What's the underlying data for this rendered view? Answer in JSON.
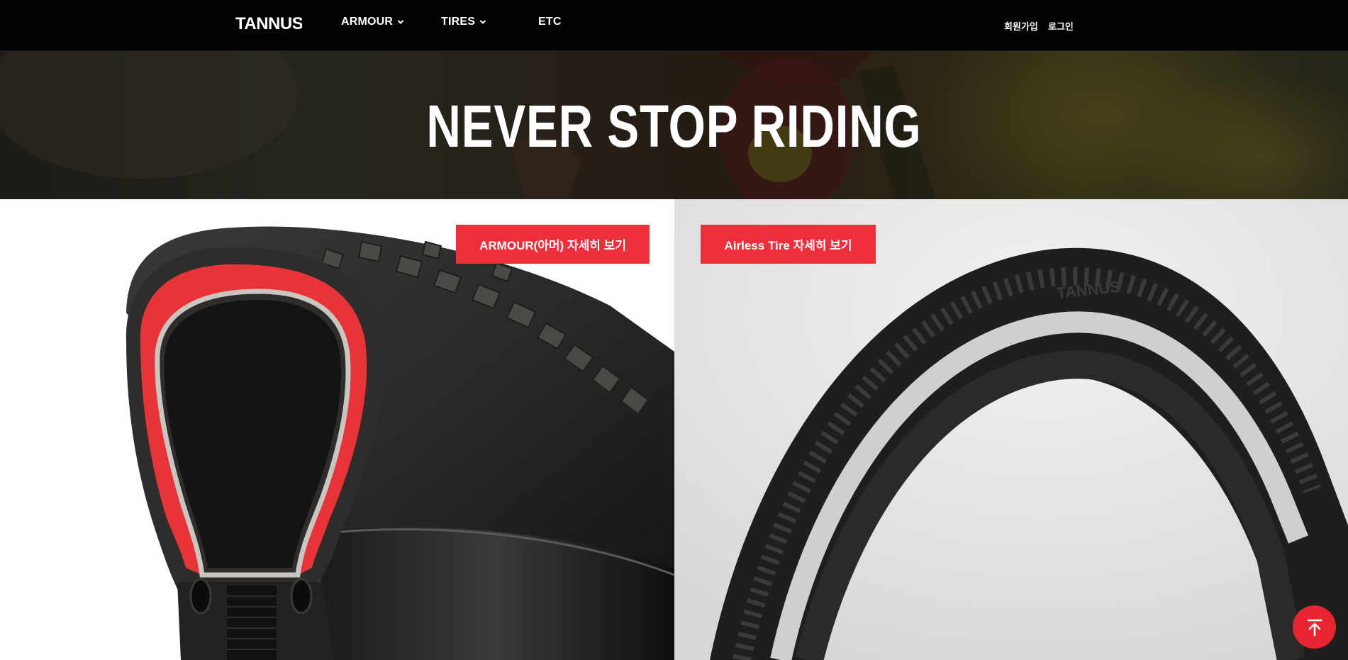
{
  "header": {
    "logo_text": "TANNUS",
    "nav": [
      {
        "label": "ARMOUR",
        "has_dropdown": true
      },
      {
        "label": "TIRES",
        "has_dropdown": true
      },
      {
        "label": "ETC",
        "has_dropdown": false
      }
    ],
    "account": {
      "signup_label": "회원가입",
      "login_label": "로그인"
    }
  },
  "hero": {
    "title": "NEVER STOP RIDING"
  },
  "products": {
    "armour": {
      "cta_label": "ARMOUR(아머) 자세히 보기",
      "icon": "tire-armour-cross-section"
    },
    "airless": {
      "cta_label": "Airless Tire 자세히 보기",
      "tire_brand": "TANNUS",
      "icon": "airless-road-tire"
    }
  },
  "scroll_top": {
    "icon": "arrow-up-to-top-icon"
  },
  "colors": {
    "header_bg": "#020202",
    "accent_red": "#ed2f3b",
    "airless_bg": "#e1e1e1"
  }
}
